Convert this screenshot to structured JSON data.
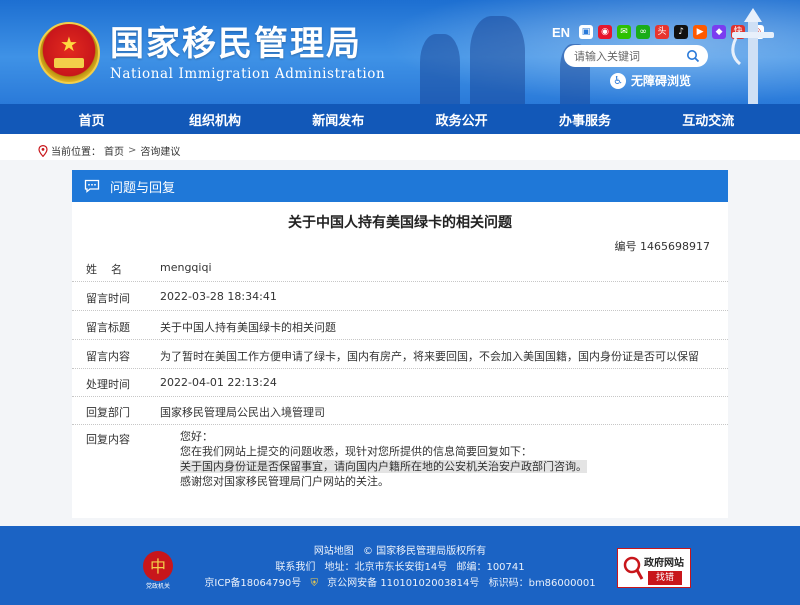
{
  "header": {
    "title": "国家移民管理局",
    "subtitle": "National Immigration Administration",
    "lang": "EN",
    "search_placeholder": "请输入关键词",
    "accessibility": "无障碍浏览",
    "social_icons": [
      "weibo-portal-icon",
      "weibo-icon",
      "wechat-icon",
      "mini-program-icon",
      "toutiao-icon",
      "tiktok-icon",
      "kuaishou-icon",
      "app-icon",
      "bilibili-icon",
      "jinritoutiao-icon"
    ]
  },
  "nav": {
    "items": [
      "首页",
      "组织机构",
      "新闻发布",
      "政务公开",
      "办事服务",
      "互动交流"
    ]
  },
  "breadcrumb": {
    "prefix": "当前位置：",
    "items": [
      "首页",
      "咨询建议"
    ],
    "separator": ">"
  },
  "panel": {
    "header": "问题与回复",
    "question_title": "关于中国人持有美国绿卡的相关问题",
    "number_label": "编号",
    "number": "1465698917",
    "fields": [
      {
        "label": "姓名",
        "value": "mengqiqi"
      },
      {
        "label": "留言时间",
        "value": "2022-03-28 18:34:41"
      },
      {
        "label": "留言标题",
        "value": "关于中国人持有美国绿卡的相关问题"
      },
      {
        "label": "留言内容",
        "value": "为了暂时在美国工作方便申请了绿卡，国内有房产，将来要回国，不会加入美国国籍，国内身份证是否可以保留"
      },
      {
        "label": "处理时间",
        "value": "2022-04-01 22:13:24"
      },
      {
        "label": "回复部门",
        "value": "国家移民管理局公民出入境管理司"
      }
    ],
    "reply_label": "回复内容",
    "reply_lines": [
      "您好：",
      "您在我们网站上提交的问题收悉，现针对您所提供的信息简要回复如下：",
      "关于国内身份证是否保留事宜，请向国内户籍所在地的公安机关治安户政部门咨询。",
      "感谢您对国家移民管理局门户网站的关注。"
    ]
  },
  "footer": {
    "sitemap": "网站地图",
    "copyright": "© 国家移民管理局版权所有",
    "contact": "联系我们",
    "address": "地址：北京市东长安街14号",
    "postcode": "邮编：100741",
    "icp": "京ICP备18064790号",
    "police": "京公网安备 11010102003814号",
    "site_id": "标识码：bm86000001",
    "emblem_text": "党政机关",
    "gov_badge_title": "政府网站",
    "gov_badge_action": "找错"
  },
  "colors": {
    "header_blue": "#2a7ad9",
    "nav_blue": "#1258b8",
    "panel_header_blue": "#1f78d8",
    "footer_blue": "#1b63c4",
    "badge_red": "#c8161b"
  }
}
